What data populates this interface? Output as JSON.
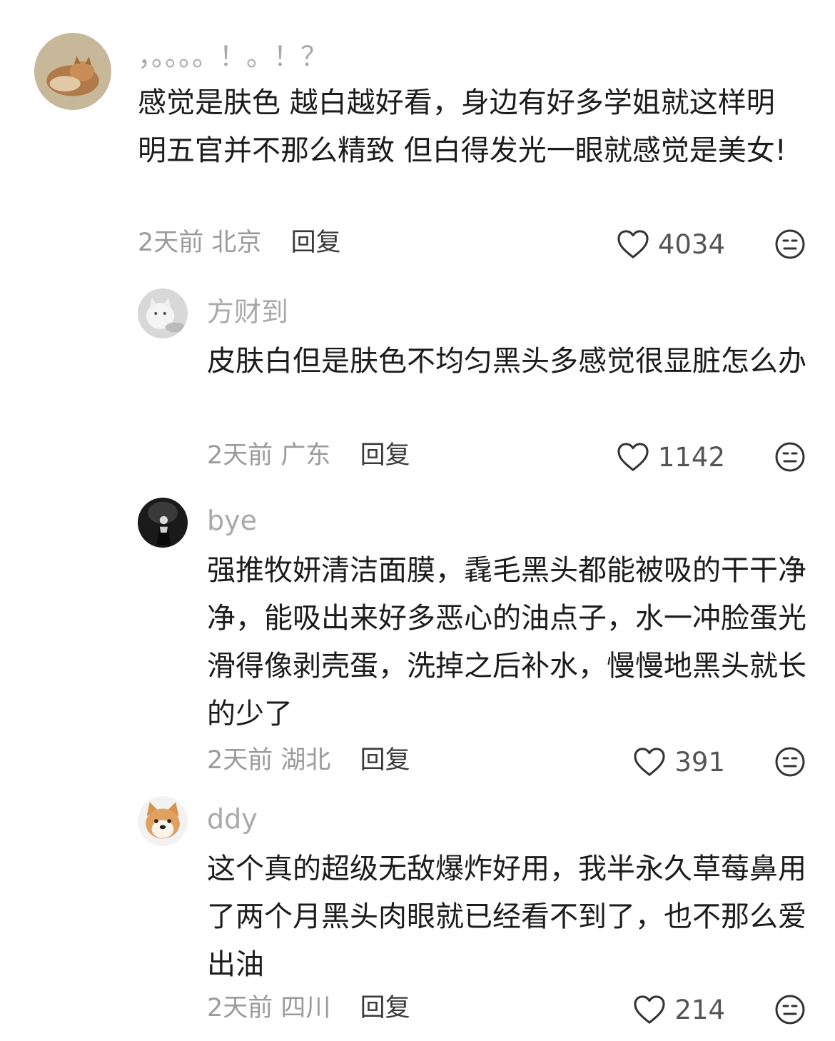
{
  "comments": [
    {
      "username": "，。。。。！。！？",
      "text": "感觉是肤色 越白越好看，身边有好多学姐就这样明明五官并不那么精致 但白得发光一眼就感觉是美女!",
      "time": "2天前",
      "location": "北京",
      "reply_label": "回复",
      "likes": "4034",
      "avatar_icon": "cat-avatar-icon"
    },
    {
      "username": "方财到",
      "text": "皮肤白但是肤色不均匀黑头多感觉很显脏怎么办",
      "time": "2天前",
      "location": "广东",
      "reply_label": "回复",
      "likes": "1142",
      "avatar_icon": "white-cat-avatar-icon"
    },
    {
      "username": "bye",
      "text": "强推牧妍清洁面膜，毳毛黑头都能被吸的干干净净，能吸出来好多恶心的油点子，水一冲脸蛋光滑得像剥壳蛋，洗掉之后补水，慢慢地黑头就长的少了",
      "time": "2天前",
      "location": "湖北",
      "reply_label": "回复",
      "likes": "391",
      "avatar_icon": "dark-figure-avatar-icon"
    },
    {
      "username": "ddy",
      "text": "这个真的超级无敌爆炸好用，我半永久草莓鼻用了两个月黑头肉眼就已经看不到了，也不那么爱出油",
      "time": "2天前",
      "location": "四川",
      "reply_label": "回复",
      "likes": "214",
      "avatar_icon": "shiba-dog-avatar-icon"
    }
  ]
}
